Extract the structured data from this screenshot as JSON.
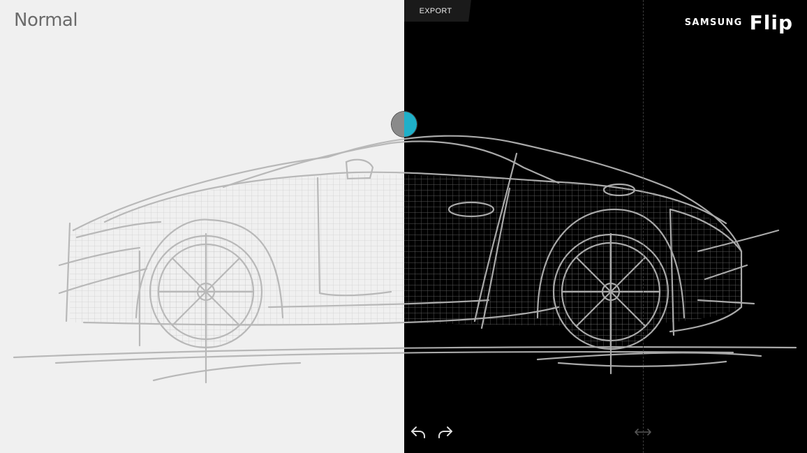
{
  "view": {
    "mode_label": "Normal",
    "export_label": "EXPORT"
  },
  "brand": {
    "samsung": "SAMSUNG",
    "flip": "Flip"
  },
  "toolbar": {
    "undo_icon": "undo-icon",
    "redo_icon": "redo-icon",
    "resize_icon": "horizontal-resize-icon"
  },
  "colors": {
    "left_background": "#f0f0f0",
    "right_background": "#000000",
    "accent": "#1fb0c9"
  }
}
